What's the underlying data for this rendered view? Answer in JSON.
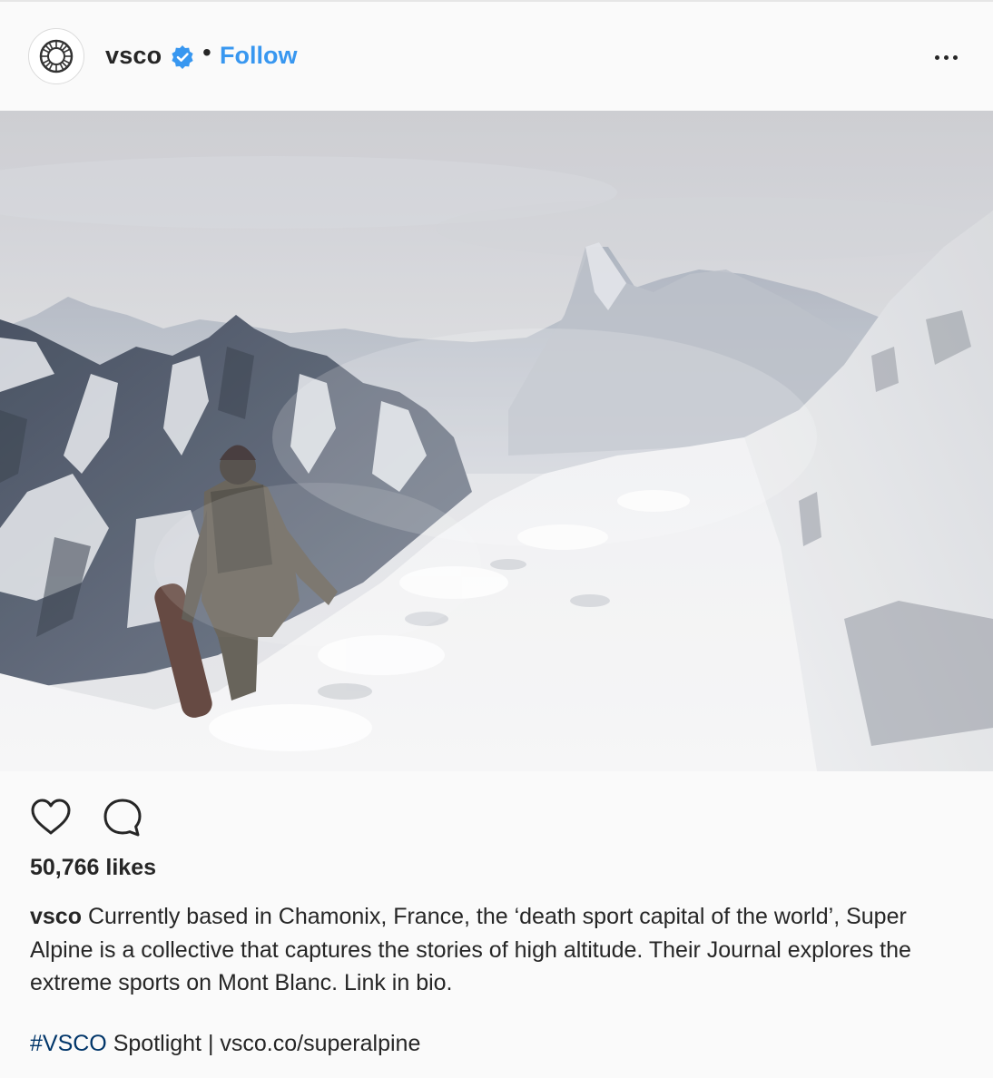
{
  "post": {
    "username": "vsco",
    "separator": "•",
    "follow_label": "Follow",
    "photo_alt": "Person carrying a snowboard walking along a snowy alpine ridge",
    "likes": "50,766 likes",
    "caption_user": "vsco",
    "caption_text": "Currently based in Chamonix, France, the ‘death sport capital of the world’, Super Alpine is a collective that captures the stories of high altitude. Their Journal explores the extreme sports on Mont Blanc. Link in bio.",
    "hashtag": "#VSCO",
    "spotlight_text": " Spotlight | vsco.co/superalpine"
  },
  "icons": {
    "avatar": "vsco-logo-icon",
    "verified": "verified-badge-icon",
    "more": "more-options-icon",
    "like": "heart-icon",
    "comment": "comment-icon"
  },
  "colors": {
    "follow": "#3897f0",
    "verified": "#3897f0",
    "hashtag": "#003569",
    "text": "#262626"
  }
}
